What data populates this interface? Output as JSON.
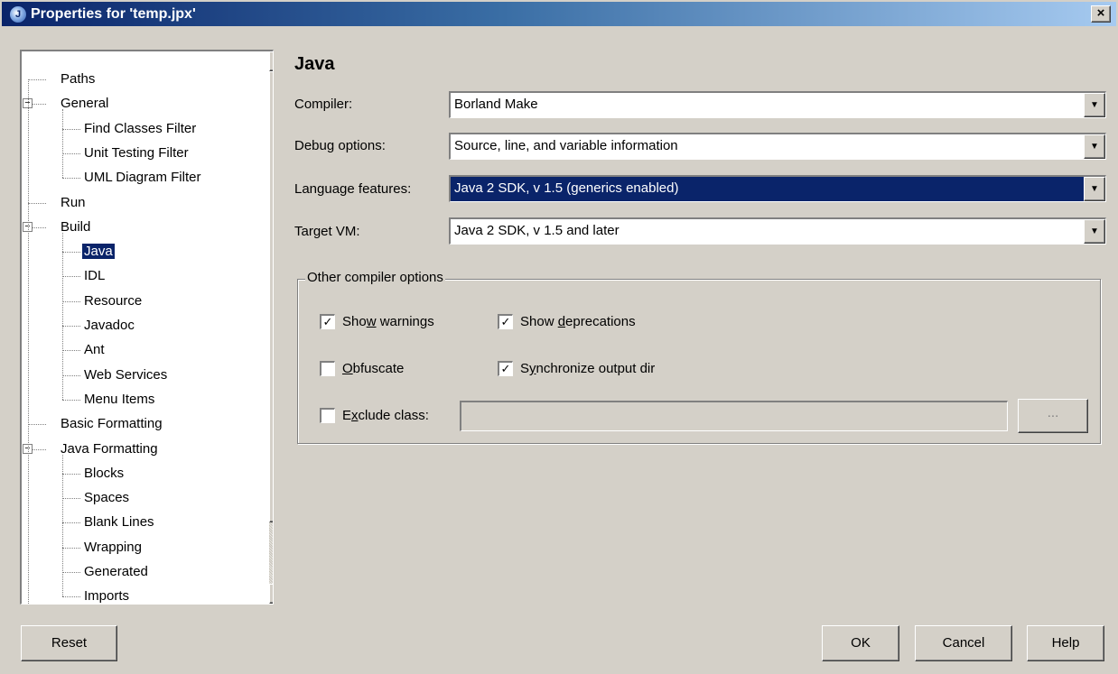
{
  "window": {
    "title": "Properties for 'temp.jpx'",
    "close_label": "×"
  },
  "tree": {
    "items": [
      {
        "label": "Paths",
        "level": 0,
        "expander": null
      },
      {
        "label": "General",
        "level": 0,
        "expander": "−"
      },
      {
        "label": "Find Classes Filter",
        "level": 1,
        "expander": null
      },
      {
        "label": "Unit Testing Filter",
        "level": 1,
        "expander": null
      },
      {
        "label": "UML Diagram Filter",
        "level": 1,
        "expander": null
      },
      {
        "label": "Run",
        "level": 0,
        "expander": null
      },
      {
        "label": "Build",
        "level": 0,
        "expander": "−"
      },
      {
        "label": "Java",
        "level": 1,
        "expander": null,
        "selected": true
      },
      {
        "label": "IDL",
        "level": 1,
        "expander": null
      },
      {
        "label": "Resource",
        "level": 1,
        "expander": null
      },
      {
        "label": "Javadoc",
        "level": 1,
        "expander": null
      },
      {
        "label": "Ant",
        "level": 1,
        "expander": null
      },
      {
        "label": "Web Services",
        "level": 1,
        "expander": null
      },
      {
        "label": "Menu Items",
        "level": 1,
        "expander": null
      },
      {
        "label": "Basic Formatting",
        "level": 0,
        "expander": null
      },
      {
        "label": "Java Formatting",
        "level": 0,
        "expander": "−"
      },
      {
        "label": "Blocks",
        "level": 1,
        "expander": null
      },
      {
        "label": "Spaces",
        "level": 1,
        "expander": null
      },
      {
        "label": "Blank Lines",
        "level": 1,
        "expander": null
      },
      {
        "label": "Wrapping",
        "level": 1,
        "expander": null
      },
      {
        "label": "Generated",
        "level": 1,
        "expander": null
      },
      {
        "label": "Imports",
        "level": 1,
        "expander": null
      }
    ]
  },
  "panel": {
    "heading": "Java",
    "compiler_label": "Compiler:",
    "compiler_value": "Borland Make",
    "debug_label": "Debug options:",
    "debug_value": "Source, line, and variable information",
    "language_label": "Language features:",
    "language_value": "Java 2 SDK, v 1.5 (generics enabled)",
    "target_label": "Target VM:",
    "target_value": "Java 2 SDK, v 1.5 and later"
  },
  "group": {
    "title": "Other compiler options",
    "show_warnings": {
      "pre": "Sho",
      "u": "w",
      "post": " warnings",
      "checked": true
    },
    "show_deprecations": {
      "pre": "Show ",
      "u": "d",
      "post": "eprecations",
      "checked": true
    },
    "obfuscate": {
      "pre": "",
      "u": "O",
      "post": "bfuscate",
      "checked": false
    },
    "synchronize": {
      "pre": "S",
      "u": "y",
      "post": "nchronize output dir",
      "checked": true
    },
    "exclude": {
      "pre": "E",
      "u": "x",
      "post": "clude class:",
      "checked": false
    },
    "exclude_value": "",
    "dots_label": "..."
  },
  "buttons": {
    "reset": "Reset",
    "ok": "OK",
    "cancel": "Cancel",
    "help": "Help"
  },
  "check_mark": "✓"
}
